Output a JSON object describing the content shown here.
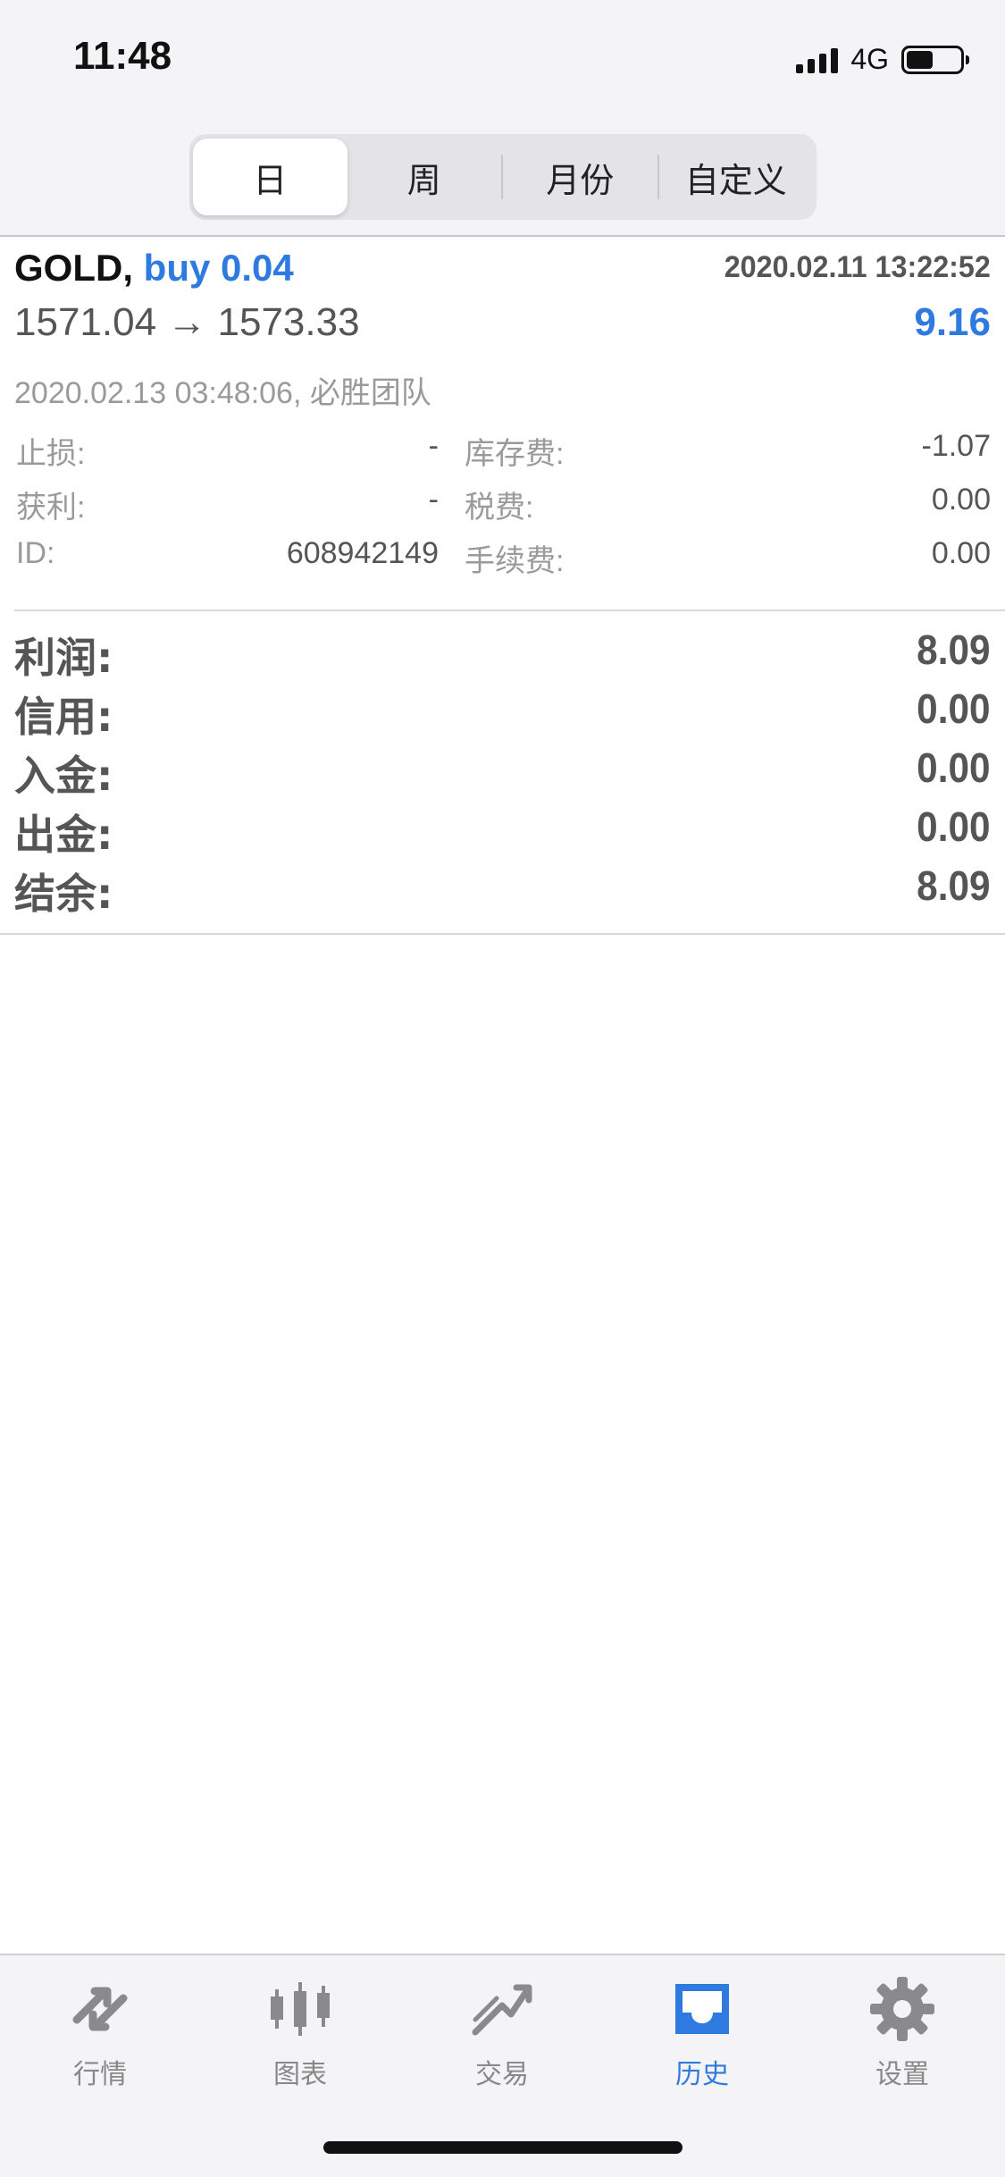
{
  "status": {
    "time": "11:48",
    "network": "4G",
    "battery_percent": 50
  },
  "segments": [
    {
      "label": "日",
      "active": true
    },
    {
      "label": "周",
      "active": false
    },
    {
      "label": "月份",
      "active": false
    },
    {
      "label": "自定义",
      "active": false
    }
  ],
  "trade": {
    "symbol": "GOLD,",
    "direction": "buy 0.04",
    "open_time": "2020.02.11 13:22:52",
    "prices": "1571.04 → 1573.33",
    "profit": "9.16",
    "close_info": "2020.02.13 03:48:06, 必胜团队",
    "fields": {
      "sl_label": "止损:",
      "sl_value": "-",
      "tp_label": "获利:",
      "tp_value": "-",
      "id_label": "ID:",
      "id_value": "608942149",
      "swap_label": "库存费:",
      "swap_value": "-1.07",
      "tax_label": "税费:",
      "tax_value": "0.00",
      "commission_label": "手续费:",
      "commission_value": "0.00"
    }
  },
  "summary": [
    {
      "label": "利润:",
      "value": "8.09"
    },
    {
      "label": "信用:",
      "value": "0.00"
    },
    {
      "label": "入金:",
      "value": "0.00"
    },
    {
      "label": "出金:",
      "value": "0.00"
    },
    {
      "label": "结余:",
      "value": "8.09"
    }
  ],
  "tabs": [
    {
      "label": "行情",
      "icon": "quotes-arrows-icon",
      "active": false
    },
    {
      "label": "图表",
      "icon": "candlestick-chart-icon",
      "active": false
    },
    {
      "label": "交易",
      "icon": "trade-trend-icon",
      "active": false
    },
    {
      "label": "历史",
      "icon": "history-inbox-icon",
      "active": true
    },
    {
      "label": "设置",
      "icon": "settings-gear-icon",
      "active": false
    }
  ],
  "colors": {
    "accent": "#2f7ae0",
    "text": "#555555",
    "muted": "#9a9a9a",
    "inactive_icon": "#8a8a8e"
  }
}
